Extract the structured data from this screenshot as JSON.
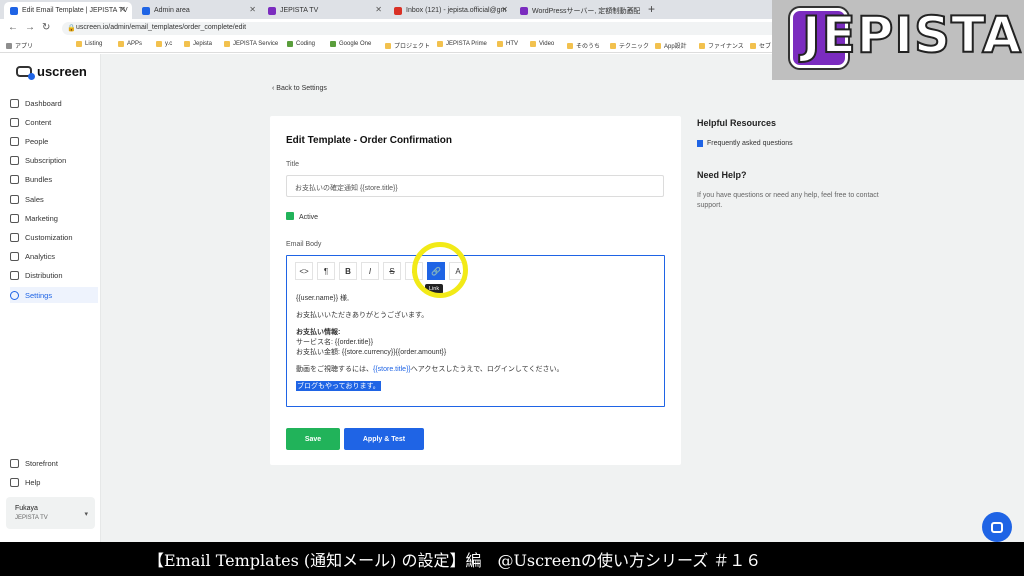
{
  "browser": {
    "tabs": [
      {
        "label": "Edit Email Template | JEPISTA TV",
        "color": "#1f64e5"
      },
      {
        "label": "Admin area",
        "color": "#1f64e5"
      },
      {
        "label": "JEPISTA TV",
        "color": "#7b2cbf"
      },
      {
        "label": "Inbox (121) - jepista.official@gm",
        "color": "#d93025"
      },
      {
        "label": "WordPressサーバー, 定額制動画配",
        "color": "#7b2cbf"
      }
    ],
    "url": "uscreen.io/admin/email_templates/order_complete/edit",
    "bookmarks": [
      "アプリ",
      "Listing",
      "APPs",
      "y.c",
      "Jepista",
      "JEPISTA Service",
      "Coding",
      "Google One",
      "プロジェクト",
      "JEPISTA Prime",
      "HTV",
      "Video",
      "そのうち",
      "テクニック",
      "App設計",
      "ファイナンス",
      "セブ"
    ]
  },
  "overlay_logo": "JEPISTA",
  "sidebar": {
    "brand": "uscreen",
    "items": [
      {
        "label": "Dashboard",
        "icon": "grid-icon"
      },
      {
        "label": "Content",
        "icon": "folder-icon"
      },
      {
        "label": "People",
        "icon": "people-icon"
      },
      {
        "label": "Subscription",
        "icon": "refresh-icon"
      },
      {
        "label": "Bundles",
        "icon": "box-icon"
      },
      {
        "label": "Sales",
        "icon": "dollar-icon"
      },
      {
        "label": "Marketing",
        "icon": "megaphone-icon"
      },
      {
        "label": "Customization",
        "icon": "edit-icon"
      },
      {
        "label": "Analytics",
        "icon": "chart-icon"
      },
      {
        "label": "Distribution",
        "icon": "distribution-icon"
      },
      {
        "label": "Settings",
        "icon": "gear-icon"
      }
    ],
    "bottom": [
      {
        "label": "Storefront",
        "icon": "storefront-icon"
      },
      {
        "label": "Help",
        "icon": "help-icon"
      }
    ],
    "account": {
      "name": "Fukaya",
      "org": "JEPISTA TV"
    }
  },
  "main": {
    "back_link": "Back to Settings",
    "card": {
      "title": "Edit Template - Order Confirmation",
      "title_label": "Title",
      "title_value": "お支払いの確定通知 {{store.title}}",
      "active_label": "Active",
      "body_label": "Email Body",
      "toolbar": [
        "<>",
        "¶",
        "B",
        "I",
        "S",
        "≡",
        "🔗",
        "A"
      ],
      "tooltip": "Link",
      "body": {
        "line1": "{{user.name}} 様,",
        "line2": "お支払いいただきありがとうございます。",
        "line3": "お支払い情報:",
        "line4": "サービス名: {{order.title}}",
        "line5": "お支払い金額: {{store.currency}}{{order.amount}}",
        "line6_pre": "動画をご視聴するには、",
        "line6_var": "{{store.title}}",
        "line6_post": "へアクセスしたうえで、ログインしてください。",
        "line7": "ブログもやっております。"
      },
      "save_label": "Save",
      "apply_label": "Apply & Test"
    },
    "resources": {
      "title": "Helpful Resources",
      "link": "Frequently asked questions",
      "help_title": "Need Help?",
      "help_text": "If you have questions or need any help, feel free to contact support."
    }
  },
  "caption": "【Email Templates (通知メール) の設定】編　@Uscreenの使い方シリーズ ＃１６"
}
